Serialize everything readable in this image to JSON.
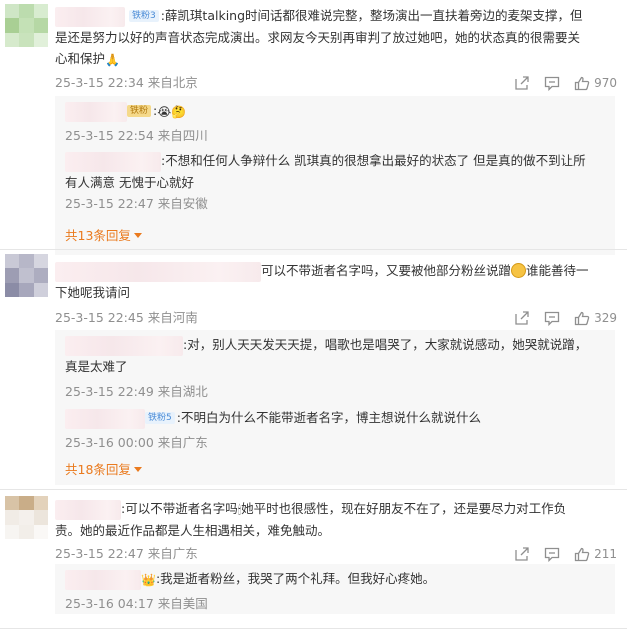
{
  "comments": [
    {
      "badge": "铁粉3",
      "text": ":薛凯琪talking时间话都很难说完整，整场演出一直扶着旁边的麦架支撑，但是还是努力以好的声音状态完成演出。求网友今天别再审判了放过她吧，她的状态真的很需要关心和保护",
      "text_line1": ":薛凯琪talking时间话都很难说完整，整场演出一直扶着旁边的麦架支撑，但",
      "text_line2": "是还是努力以好的声音状态完成演出。求网友今天别再审判了放过她吧，她的状态真的很需要关",
      "text_line3": "心和保护",
      "emoji_end": "🙏",
      "time": "25-3-15 22:34",
      "location": "来自北京",
      "likes": "970",
      "replies": [
        {
          "badge": "铁粉",
          "text": ":",
          "emoji": "😭🤔",
          "time": "25-3-15 22:54",
          "location": "来自四川"
        },
        {
          "text_line1": ":不想和任何人争辩什么 凯琪真的很想拿出最好的状态了 但是真的做不到让所",
          "text_line2": "有人满意 无愧于心就好",
          "time": "25-3-15 22:47",
          "location": "来自安徽"
        }
      ],
      "more_replies": "共13条回复"
    },
    {
      "text_line1": "可以不带逝者名字吗，又要被他部分粉丝说蹭",
      "text_line1b": "谁能善待一",
      "text_line2": "下她呢我请问",
      "time": "25-3-15 22:45",
      "location": "来自河南",
      "likes": "329",
      "replies": [
        {
          "text_line1": ":对，别人天天发天天提，唱歌也是唱哭了，大家就说感动，她哭就说蹭，",
          "text_line2": "真是太难了",
          "time": "25-3-15 22:49",
          "location": "来自湖北"
        },
        {
          "badge": "铁粉5",
          "text": ":不明白为什么不能带逝者名字，博主想说什么就说什么",
          "time": "25-3-16 00:00",
          "location": "来自广东"
        }
      ],
      "more_replies": "共18条回复"
    },
    {
      "text_line1": ":可以不带逝者名字吗",
      "text_line1b": "她平时也很感性，现在好朋友不在了，还是要尽力对工作负",
      "text_line2": "责。她的最近作品都是人生相遇相关，难免触动。",
      "time": "25-3-15 22:47",
      "location": "来自广东",
      "likes": "211",
      "replies": [
        {
          "text": ":我是逝者粉丝，我哭了两个礼拜。但我好心疼她。",
          "time": "25-3-16 04:17",
          "location": "来自美国"
        }
      ]
    }
  ],
  "icons": {
    "share": "share-icon",
    "comment": "comment-icon",
    "like": "like-icon"
  },
  "colors": {
    "more_link": "#ea7a1e",
    "meta_text": "#8f8f8f",
    "reply_bg": "#f7f7f7",
    "badge_blue": "#4a8bd6"
  }
}
